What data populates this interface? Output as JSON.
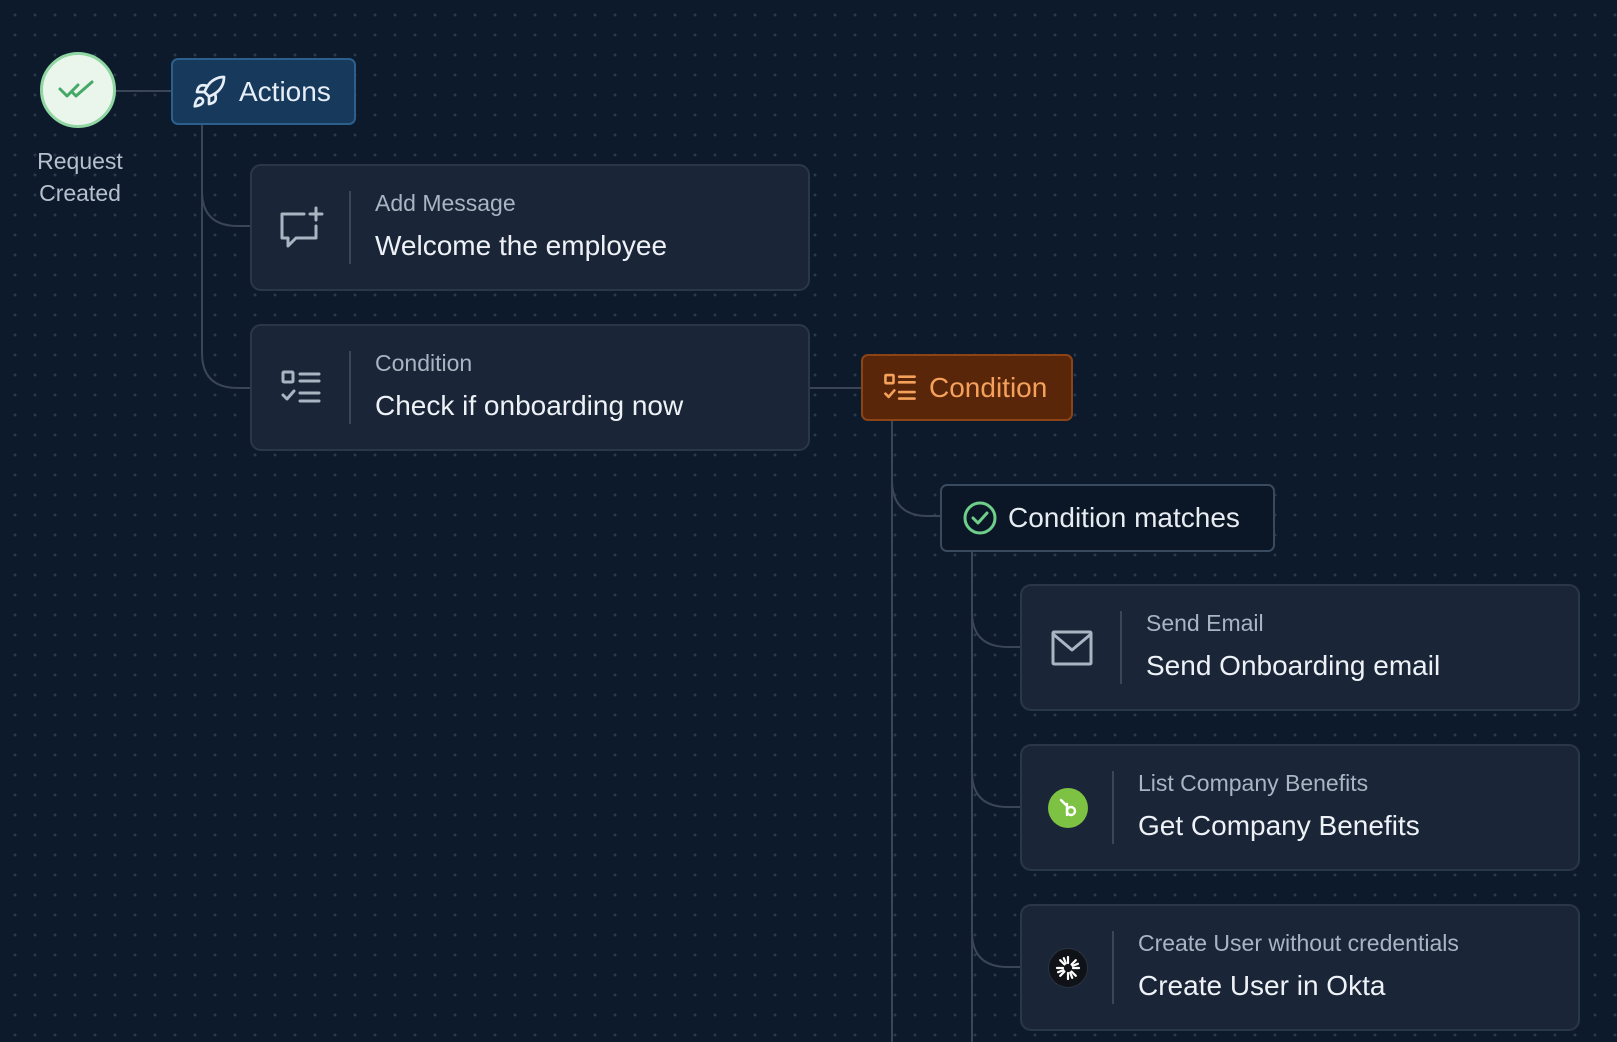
{
  "start": {
    "label_line1": "Request",
    "label_line2": "Created",
    "icon": "double-check-icon"
  },
  "actions_pill": {
    "label": "Actions",
    "icon": "rocket-icon"
  },
  "steps": [
    {
      "kind": "Add Message",
      "title": "Welcome the employee",
      "icon": "message-plus-icon"
    },
    {
      "kind": "Condition",
      "title": "Check if onboarding now",
      "icon": "checklist-icon"
    }
  ],
  "condition_pill": {
    "label": "Condition",
    "icon": "checklist-icon"
  },
  "condition_match": {
    "label": "Condition matches",
    "icon": "check-circle-icon"
  },
  "branch_steps": [
    {
      "kind": "Send Email",
      "title": "Send Onboarding email",
      "icon": "mail-icon"
    },
    {
      "kind": "List Company Benefits",
      "title": "Get Company Benefits",
      "icon": "bamboohr-logo-icon"
    },
    {
      "kind": "Create User without credentials",
      "title": "Create User in Okta",
      "icon": "okta-logo-icon"
    }
  ],
  "colors": {
    "background": "#0c1a2b",
    "card": "#1a2637",
    "actions_accent": "#17395c",
    "condition_accent": "#5a2609",
    "condition_text": "#f4a15c",
    "success": "#6fcf8a"
  }
}
